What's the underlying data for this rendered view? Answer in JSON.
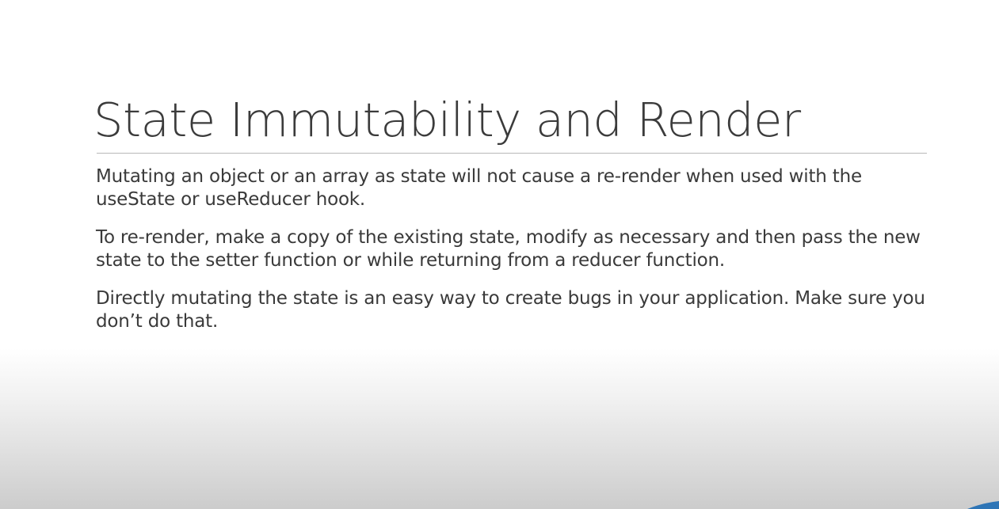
{
  "slide": {
    "title": "State Immutability and Render",
    "paragraphs": [
      "Mutating an object or an array as state will not cause a re-render when used with the useState or useReducer hook.",
      "To re-render, make a copy of the existing state, modify as necessary and then pass the new state to the setter function or while returning from a reducer function.",
      "Directly mutating the state is an easy way to create bugs in your application. Make sure you don’t do that."
    ]
  },
  "colors": {
    "title_text": "#3b3b3b",
    "body_text": "#3a3a3a",
    "rule": "#b8b8b8",
    "accent": "#2e75b6"
  }
}
